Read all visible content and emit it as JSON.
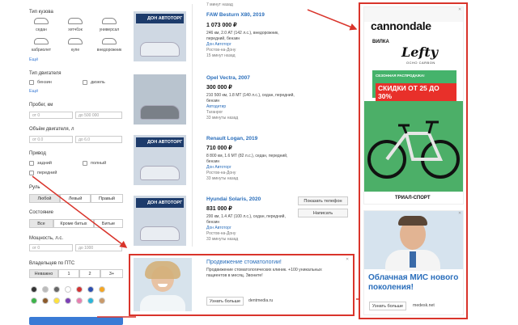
{
  "filters": {
    "body_type": {
      "label": "Тип кузова",
      "items": [
        "седан",
        "хетчбэк",
        "универсал",
        "кабриолет",
        "купе",
        "внедорожник"
      ],
      "more": "Ещё"
    },
    "engine": {
      "label": "Тип двигателя",
      "options": [
        "бензин",
        "дизель"
      ],
      "more": "Ещё"
    },
    "mileage": {
      "label": "Пробег, км",
      "from": "от 0",
      "to": "до 500 000"
    },
    "volume": {
      "label": "Объём двигателя, л",
      "from": "от 0.0",
      "to": "до 6.0"
    },
    "drive": {
      "label": "Привод",
      "options": [
        "задний",
        "полный",
        "передний"
      ]
    },
    "wheel": {
      "label": "Руль",
      "options": [
        "Любой",
        "Левый",
        "Правый"
      ]
    },
    "condition": {
      "label": "Состояние",
      "options": [
        "Все",
        "Кроме битых",
        "Битые"
      ]
    },
    "power": {
      "label": "Мощность, л.с.",
      "from": "от 0",
      "to": "до 1000"
    },
    "owners": {
      "label": "Владельцев по ПТС",
      "options": [
        "Неважно",
        "1",
        "2",
        "3+"
      ]
    },
    "colors": [
      "#333333",
      "#bbbbbb",
      "#666666",
      "#ffffff",
      "#d23232",
      "#2d4fb0",
      "#f5a623",
      "#3db34a",
      "#8b5a2b",
      "#ffe23d",
      "#7b3fb5",
      "#e87fb0",
      "#2bb5d9",
      "#c99a6b"
    ]
  },
  "listings": [
    {
      "logo": "ДОН АВТОТОРГ",
      "title": "FAW Besturn X80, 2019",
      "price": "1 073 000 ₽",
      "spec": "246 км, 2.0 AT (142 л.с.), внедорожник, передний, бензин",
      "seller": "Дон Автоторг",
      "city": "Ростов-на-Дону",
      "time": "15 минут назад"
    },
    {
      "logo": "",
      "title": "Opel Vectra, 2007",
      "price": "300 000 ₽",
      "spec": "210 500 км, 1.8 MT (140 л.с.), седан, передний, бензин",
      "seller": "Автодетир",
      "city": "Таганрог",
      "time": "33 минуты назад"
    },
    {
      "logo": "ДОН АВТОТОРГ",
      "title": "Renault Logan, 2019",
      "price": "710 000 ₽",
      "spec": "8 800 км, 1.6 MT (82 л.с.), седан, передний, бензин",
      "seller": "Дон Автоторг",
      "city": "Ростов-на-Дону",
      "time": "33 минуты назад"
    },
    {
      "logo": "ДОН АВТОТОРГ",
      "title": "Hyundai Solaris, 2020",
      "price": "831 000 ₽",
      "spec": "200 км, 1.4 AT (100 л.с.), седан, передний, бензин",
      "seller": "Дон Автоторг",
      "city": "Ростов-на-Дону",
      "time": "33 минуты назад"
    }
  ],
  "listing_top_time": "7 минут назад",
  "actions": {
    "phone": "Показать телефон",
    "write": "Написать"
  },
  "ad_dental": {
    "title": "Продвижение стоматологии!",
    "text": "Продвижение стоматологических клиник. +100 уникальных пациентов в месяц. Звоните!",
    "button": "Узнать больше",
    "domain": "dentmedia.ru"
  },
  "ad_bike": {
    "brand": "cannondale",
    "fork": "ВИЛКА",
    "model": "Lefty",
    "model_sub": "OCHO CARBON",
    "promo": "СЕЗОННАЯ РАСПРОДАЖА!",
    "discount": "СКИДКИ ОТ 25 ДО 30%",
    "store": "ТРИАЛ-СПОРТ"
  },
  "ad_mis": {
    "headline": "Облачная МИС нового поколения!",
    "button": "Узнать больше",
    "domain": "medesk.net"
  },
  "colors": {
    "link": "#2a6ebb",
    "accent_red": "#d9342b",
    "ad_green": "#45b36b",
    "primary": "#3a7bd5"
  }
}
